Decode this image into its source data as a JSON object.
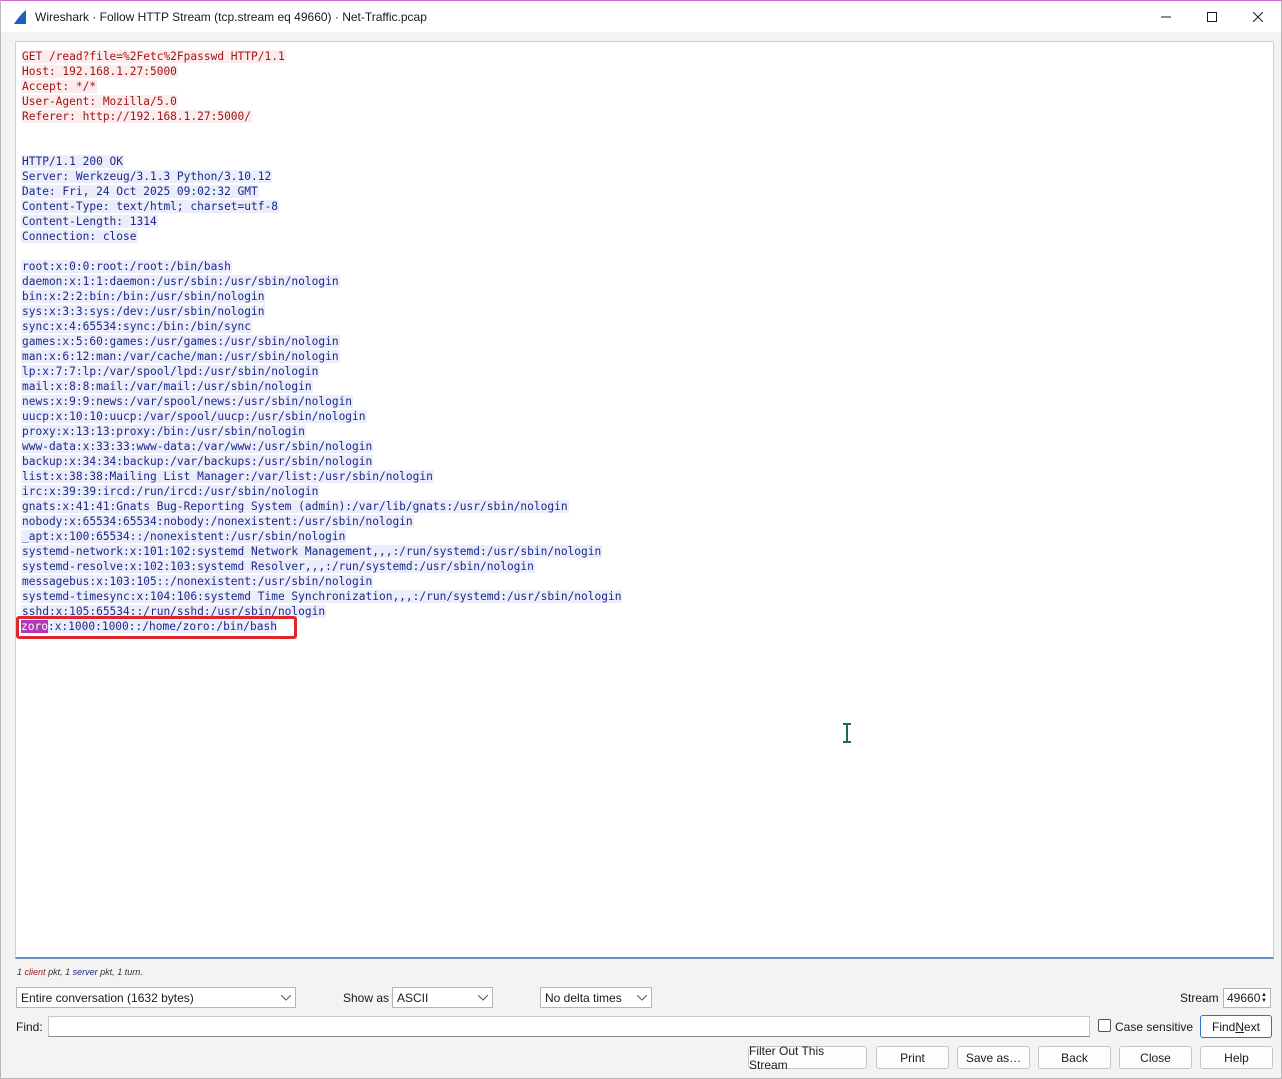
{
  "window": {
    "title": "Wireshark · Follow HTTP Stream (tcp.stream eq 49660) · Net-Traffic.pcap"
  },
  "request_lines": [
    "GET /read?file=%2Fetc%2Fpasswd HTTP/1.1",
    "Host: 192.168.1.27:5000",
    "Accept: */*",
    "User-Agent: Mozilla/5.0",
    "Referer: http://192.168.1.27:5000/"
  ],
  "response_header_lines": [
    "HTTP/1.1 200 OK",
    "Server: Werkzeug/3.1.3 Python/3.10.12",
    "Date: Fri, 24 Oct 2025 09:02:32 GMT",
    "Content-Type: text/html; charset=utf-8",
    "Content-Length: 1314",
    "Connection: close"
  ],
  "response_body_lines": [
    "root:x:0:0:root:/root:/bin/bash",
    "daemon:x:1:1:daemon:/usr/sbin:/usr/sbin/nologin",
    "bin:x:2:2:bin:/bin:/usr/sbin/nologin",
    "sys:x:3:3:sys:/dev:/usr/sbin/nologin",
    "sync:x:4:65534:sync:/bin:/bin/sync",
    "games:x:5:60:games:/usr/games:/usr/sbin/nologin",
    "man:x:6:12:man:/var/cache/man:/usr/sbin/nologin",
    "lp:x:7:7:lp:/var/spool/lpd:/usr/sbin/nologin",
    "mail:x:8:8:mail:/var/mail:/usr/sbin/nologin",
    "news:x:9:9:news:/var/spool/news:/usr/sbin/nologin",
    "uucp:x:10:10:uucp:/var/spool/uucp:/usr/sbin/nologin",
    "proxy:x:13:13:proxy:/bin:/usr/sbin/nologin",
    "www-data:x:33:33:www-data:/var/www:/usr/sbin/nologin",
    "backup:x:34:34:backup:/var/backups:/usr/sbin/nologin",
    "list:x:38:38:Mailing List Manager:/var/list:/usr/sbin/nologin",
    "irc:x:39:39:ircd:/run/ircd:/usr/sbin/nologin",
    "gnats:x:41:41:Gnats Bug-Reporting System (admin):/var/lib/gnats:/usr/sbin/nologin",
    "nobody:x:65534:65534:nobody:/nonexistent:/usr/sbin/nologin",
    "_apt:x:100:65534::/nonexistent:/usr/sbin/nologin",
    "systemd-network:x:101:102:systemd Network Management,,,:/run/systemd:/usr/sbin/nologin",
    "systemd-resolve:x:102:103:systemd Resolver,,,:/run/systemd:/usr/sbin/nologin",
    "messagebus:x:103:105::/nonexistent:/usr/sbin/nologin",
    "systemd-timesync:x:104:106:systemd Time Synchronization,,,:/run/systemd:/usr/sbin/nologin",
    "sshd:x:105:65534::/run/sshd:/usr/sbin/nologin"
  ],
  "highlighted_line": {
    "selected_text": "zoro",
    "rest_text": ":x:1000:1000::/home/zoro:/bin/bash"
  },
  "stats": {
    "client_count": "1",
    "client_label": "client",
    "pkt1": "pkt,",
    "server_count": "1",
    "server_label": "server",
    "pkt2": "pkt,",
    "turns": "1 turn."
  },
  "controls": {
    "conversation_select": "Entire conversation (1632 bytes)",
    "show_as_label": "Show as",
    "show_as_select": "ASCII",
    "delta_select": "No delta times",
    "stream_label": "Stream",
    "stream_value": "49660",
    "find_label": "Find:",
    "find_value": "",
    "case_sensitive_label": "Case sensitive",
    "find_next_label": "Find Next"
  },
  "buttons": {
    "filter_out": "Filter Out This Stream",
    "print": "Print",
    "save_as": "Save as…",
    "back": "Back",
    "close": "Close",
    "help": "Help"
  },
  "colors": {
    "client_text": "#a31515",
    "server_text": "#1b2a8a",
    "highlight_box": "#e0262d",
    "selection": "#b338b8"
  }
}
